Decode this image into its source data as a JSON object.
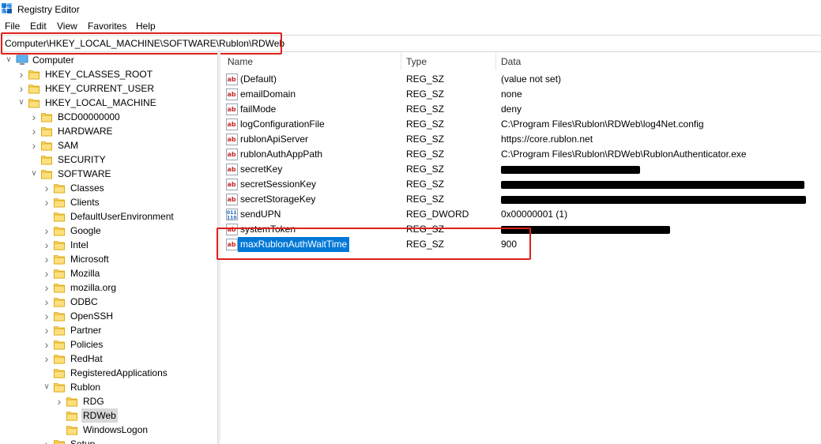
{
  "window": {
    "title": "Registry Editor"
  },
  "menu": [
    {
      "label": "File"
    },
    {
      "label": "Edit"
    },
    {
      "label": "View"
    },
    {
      "label": "Favorites"
    },
    {
      "label": "Help"
    }
  ],
  "address": {
    "path": "Computer\\HKEY_LOCAL_MACHINE\\SOFTWARE\\Rublon\\RDWeb"
  },
  "tree": [
    {
      "label": "Computer",
      "expander": "expanded",
      "icon": "computer-icon",
      "depth": 0
    },
    {
      "label": "HKEY_CLASSES_ROOT",
      "expander": "collapsed",
      "icon": "folder-icon",
      "depth": 1
    },
    {
      "label": "HKEY_CURRENT_USER",
      "expander": "collapsed",
      "icon": "folder-icon",
      "depth": 1
    },
    {
      "label": "HKEY_LOCAL_MACHINE",
      "expander": "expanded",
      "icon": "folder-icon",
      "depth": 1
    },
    {
      "label": "BCD00000000",
      "expander": "collapsed",
      "icon": "folder-icon",
      "depth": 2
    },
    {
      "label": "HARDWARE",
      "expander": "collapsed",
      "icon": "folder-icon",
      "depth": 2
    },
    {
      "label": "SAM",
      "expander": "collapsed",
      "icon": "folder-icon",
      "depth": 2
    },
    {
      "label": "SECURITY",
      "expander": "none",
      "icon": "folder-icon",
      "depth": 2
    },
    {
      "label": "SOFTWARE",
      "expander": "expanded",
      "icon": "folder-icon",
      "depth": 2
    },
    {
      "label": "Classes",
      "expander": "collapsed",
      "icon": "folder-icon",
      "depth": 3
    },
    {
      "label": "Clients",
      "expander": "collapsed",
      "icon": "folder-icon",
      "depth": 3
    },
    {
      "label": "DefaultUserEnvironment",
      "expander": "none",
      "icon": "folder-icon",
      "depth": 3
    },
    {
      "label": "Google",
      "expander": "collapsed",
      "icon": "folder-icon",
      "depth": 3
    },
    {
      "label": "Intel",
      "expander": "collapsed",
      "icon": "folder-icon",
      "depth": 3
    },
    {
      "label": "Microsoft",
      "expander": "collapsed",
      "icon": "folder-icon",
      "depth": 3
    },
    {
      "label": "Mozilla",
      "expander": "collapsed",
      "icon": "folder-icon",
      "depth": 3
    },
    {
      "label": "mozilla.org",
      "expander": "collapsed",
      "icon": "folder-icon",
      "depth": 3
    },
    {
      "label": "ODBC",
      "expander": "collapsed",
      "icon": "folder-icon",
      "depth": 3
    },
    {
      "label": "OpenSSH",
      "expander": "collapsed",
      "icon": "folder-icon",
      "depth": 3
    },
    {
      "label": "Partner",
      "expander": "collapsed",
      "icon": "folder-icon",
      "depth": 3
    },
    {
      "label": "Policies",
      "expander": "collapsed",
      "icon": "folder-icon",
      "depth": 3
    },
    {
      "label": "RedHat",
      "expander": "collapsed",
      "icon": "folder-icon",
      "depth": 3
    },
    {
      "label": "RegisteredApplications",
      "expander": "none",
      "icon": "folder-icon",
      "depth": 3
    },
    {
      "label": "Rublon",
      "expander": "expanded",
      "icon": "folder-icon",
      "depth": 3
    },
    {
      "label": "RDG",
      "expander": "collapsed",
      "icon": "folder-icon",
      "depth": 4
    },
    {
      "label": "RDWeb",
      "expander": "none",
      "icon": "folder-icon",
      "depth": 4,
      "selected": true
    },
    {
      "label": "WindowsLogon",
      "expander": "none",
      "icon": "folder-icon",
      "depth": 4
    },
    {
      "label": "Setup",
      "expander": "collapsed",
      "icon": "folder-icon",
      "depth": 3
    }
  ],
  "columns": {
    "name": "Name",
    "type": "Type",
    "data": "Data"
  },
  "values": [
    {
      "name": "(Default)",
      "type": "REG_SZ",
      "data": "(value not set)",
      "icon": "string-value-icon"
    },
    {
      "name": "emailDomain",
      "type": "REG_SZ",
      "data": "none",
      "icon": "string-value-icon"
    },
    {
      "name": "failMode",
      "type": "REG_SZ",
      "data": "deny",
      "icon": "string-value-icon"
    },
    {
      "name": "logConfigurationFile",
      "type": "REG_SZ",
      "data": "C:\\Program Files\\Rublon\\RDWeb\\log4Net.config",
      "icon": "string-value-icon"
    },
    {
      "name": "rublonApiServer",
      "type": "REG_SZ",
      "data": "https://core.rublon.net",
      "icon": "string-value-icon"
    },
    {
      "name": "rublonAuthAppPath",
      "type": "REG_SZ",
      "data": "C:\\Program Files\\Rublon\\RDWeb\\RublonAuthenticator.exe",
      "icon": "string-value-icon"
    },
    {
      "name": "secretKey",
      "type": "REG_SZ",
      "data": "",
      "icon": "string-value-icon",
      "redacted": true
    },
    {
      "name": "secretSessionKey",
      "type": "REG_SZ",
      "data": "",
      "icon": "string-value-icon",
      "redacted": true
    },
    {
      "name": "secretStorageKey",
      "type": "REG_SZ",
      "data": "",
      "icon": "string-value-icon",
      "redacted": true
    },
    {
      "name": "sendUPN",
      "type": "REG_DWORD",
      "data": "0x00000001 (1)",
      "icon": "dword-value-icon"
    },
    {
      "name": "systemToken",
      "type": "REG_SZ",
      "data": "",
      "icon": "string-value-icon",
      "redacted": true
    },
    {
      "name": "maxRublonAuthWaitTime",
      "type": "REG_SZ",
      "data": "900",
      "icon": "string-value-icon",
      "selected": true
    }
  ],
  "colors": {
    "selection": "#0078d7",
    "annotation": "#e0201b",
    "folder": "#f8d775"
  }
}
